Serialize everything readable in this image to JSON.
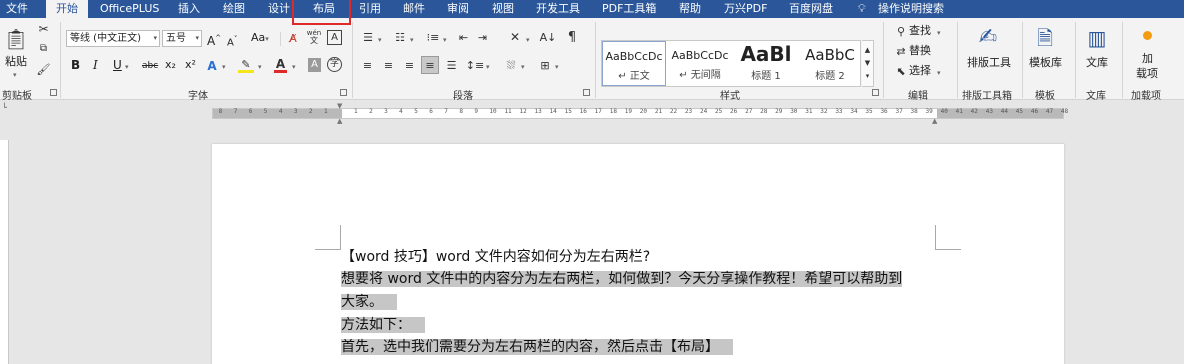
{
  "tabs": [
    "文件",
    "开始",
    "OfficePLUS",
    "插入",
    "绘图",
    "设计",
    "布局",
    "引用",
    "邮件",
    "审阅",
    "视图",
    "开发工具",
    "PDF工具箱",
    "帮助",
    "万兴PDF",
    "百度网盘"
  ],
  "tell_me": "操作说明搜索",
  "ribbon": {
    "clipboard": {
      "paste": "粘贴",
      "group": "剪贴板"
    },
    "font": {
      "name": "等线 (中文正文)",
      "size": "五号",
      "grow": "A",
      "shrink": "A",
      "case": "Aa",
      "phonetic": "wén",
      "bold": "B",
      "italic": "I",
      "underline": "U",
      "strike": "abc",
      "sub": "x₂",
      "sup": "x²",
      "color_a": "A",
      "group": "字体"
    },
    "paragraph": {
      "group": "段落"
    },
    "styles": {
      "items": [
        {
          "sample": "AaBbCcDc",
          "name": "↵ 正文"
        },
        {
          "sample": "AaBbCcDc",
          "name": "↵ 无间隔"
        },
        {
          "sample": "AaBl",
          "name": "标题 1"
        },
        {
          "sample": "AaBbC",
          "name": "标题 2"
        }
      ],
      "group": "样式"
    },
    "editing": {
      "find": "查找",
      "replace": "替换",
      "select": "选择",
      "group": "编辑"
    },
    "layout_tool": {
      "label": "排版工具",
      "group": "排版工具箱"
    },
    "template": {
      "label": "模板库",
      "group": "模板"
    },
    "library": {
      "label": "文库",
      "group": "文库"
    },
    "addins": {
      "label1": "加",
      "label2": "载项",
      "group": "加载项"
    }
  },
  "ruler": {
    "labels": [
      "8",
      "7",
      "6",
      "5",
      "4",
      "3",
      "2",
      "1",
      "1",
      "2",
      "3",
      "4",
      "5",
      "6",
      "7",
      "8",
      "9",
      "10",
      "11",
      "12",
      "13",
      "14",
      "15",
      "16",
      "17",
      "18",
      "19",
      "20",
      "21",
      "22",
      "23",
      "24",
      "25",
      "26",
      "27",
      "28",
      "29",
      "30",
      "31",
      "32",
      "33",
      "34",
      "35",
      "36",
      "37",
      "38",
      "39",
      "40",
      "41",
      "42",
      "43",
      "44",
      "45",
      "46",
      "47",
      "48"
    ]
  },
  "document": {
    "lines": [
      "【word 技巧】word 文件内容如何分为左右两栏?",
      "想要将 word 文件中的内容分为左右两栏，如何做到？今天分享操作教程！希望可以帮助到",
      "大家。",
      "方法如下：",
      "首先，选中我们需要分为左右两栏的内容，然后点击【布局】"
    ]
  },
  "colors": {
    "title_bar": "#2b579a",
    "ribbon": "#f3f3f3",
    "selection": "#c6c6c6",
    "highlight_box": "#e02a2a"
  }
}
